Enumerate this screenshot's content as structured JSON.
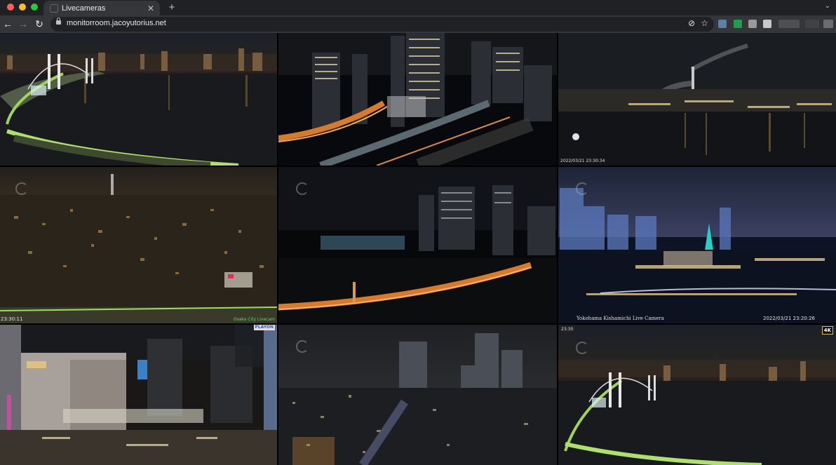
{
  "browser": {
    "tab_title": "Livecameras",
    "url": "monitorroom.jacoyutorius.net",
    "close_glyph": "✕",
    "new_tab_glyph": "+",
    "back_glyph": "←",
    "forward_glyph": "→",
    "reload_glyph": "↻",
    "menu_glyph": "⌄",
    "bookmark_glyph": "☆",
    "eye_off_glyph": "⊘"
  },
  "cameras": [
    {
      "id": "cam-1",
      "scene": "rainbow-bridge",
      "overlay": ""
    },
    {
      "id": "cam-2",
      "scene": "highway-towers",
      "overlay": ""
    },
    {
      "id": "cam-3",
      "scene": "industrial-bay",
      "overlay": "2022/03/21 23:30:34"
    },
    {
      "id": "cam-4",
      "scene": "osaka-city",
      "overlay_left": "23:30:11",
      "overlay_right": "Osaka City Livecam"
    },
    {
      "id": "cam-5",
      "scene": "dark-towers",
      "overlay": ""
    },
    {
      "id": "cam-6",
      "scene": "yokohama",
      "overlay_left": "Yokohama Kishamichi Live Camera",
      "overlay_right": "2022/03/21 23:20:26"
    },
    {
      "id": "cam-7",
      "scene": "street",
      "overlay": "PLAYON"
    },
    {
      "id": "cam-8",
      "scene": "shinjuku",
      "overlay": ""
    },
    {
      "id": "cam-9",
      "scene": "rainbow-bridge-4k",
      "overlay_left": "23:30",
      "overlay_right": "4K"
    }
  ]
}
